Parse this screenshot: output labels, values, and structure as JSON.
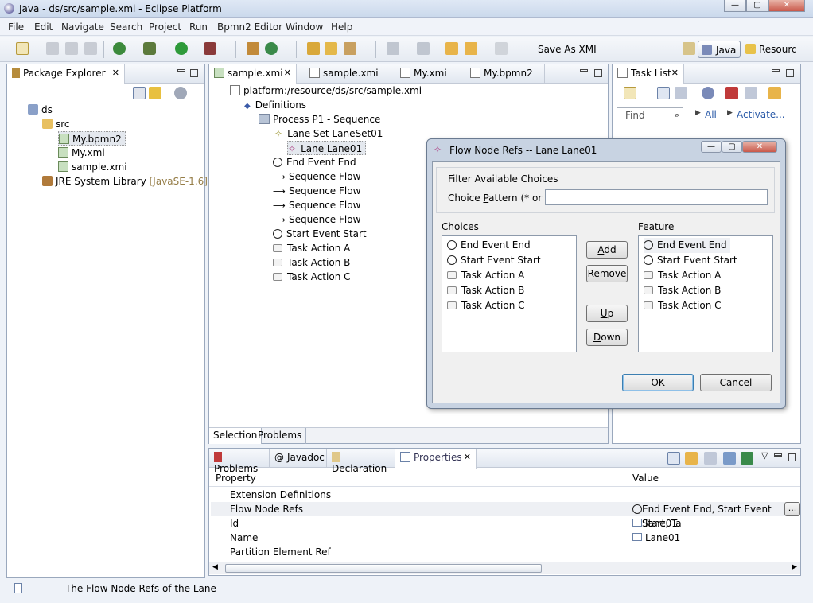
{
  "window": {
    "title": "Java - ds/src/sample.xmi - Eclipse Platform"
  },
  "menu": [
    "File",
    "Edit",
    "Navigate",
    "Search",
    "Project",
    "Run",
    "Bpmn2 Editor",
    "Window",
    "Help"
  ],
  "toolbar": {
    "save_as_xmi": "Save As XMI"
  },
  "perspectives": {
    "java": "Java",
    "resource": "Resourc"
  },
  "package_explorer": {
    "title": "Package Explorer",
    "items": [
      "ds",
      "src",
      "My.bpmn2",
      "My.xmi",
      "sample.xmi",
      "JRE System Library"
    ],
    "jre_suffix": "[JavaSE-1.6]"
  },
  "editor": {
    "tabs": [
      "sample.xmi",
      "sample.xmi",
      "My.xmi",
      "My.bpmn2"
    ],
    "tree": [
      "platform:/resource/ds/src/sample.xmi",
      "Definitions",
      "Process P1 - Sequence",
      "Lane Set LaneSet01",
      "Lane Lane01",
      "End Event End",
      "Sequence Flow",
      "Sequence Flow",
      "Sequence Flow",
      "Sequence Flow",
      "Start Event Start",
      "Task Action A",
      "Task Action B",
      "Task Action C"
    ],
    "bottom_tabs": [
      "Selection",
      "Problems"
    ]
  },
  "task_list": {
    "title": "Task List",
    "find_placeholder": "Find",
    "all": "All",
    "activate": "Activate..."
  },
  "dialog": {
    "title": "Flow Node Refs -- Lane Lane01",
    "filter_group": "Filter Available Choices",
    "choice_pattern_label": "Choice Pattern (* or ?)",
    "choice_pattern_value": "",
    "choices_label": "Choices",
    "feature_label": "Feature",
    "choices": [
      "End Event End",
      "Start Event Start",
      "Task Action A",
      "Task Action B",
      "Task Action C"
    ],
    "features": [
      "End Event End",
      "Start Event Start",
      "Task Action A",
      "Task Action B",
      "Task Action C"
    ],
    "add": "Add",
    "remove": "Remove",
    "up": "Up",
    "down": "Down",
    "ok": "OK",
    "cancel": "Cancel"
  },
  "bottom_panel": {
    "tabs": [
      "Problems",
      "Javadoc",
      "Declaration",
      "Properties"
    ],
    "col_property": "Property",
    "col_value": "Value",
    "rows": [
      {
        "name": "Extension Definitions",
        "value": ""
      },
      {
        "name": "Flow Node Refs",
        "value": "End Event End, Start Event Start, Ta"
      },
      {
        "name": "Id",
        "value": "lane01"
      },
      {
        "name": "Name",
        "value": "Lane01"
      },
      {
        "name": "Partition Element Ref",
        "value": ""
      }
    ],
    "ellipsis": "..."
  },
  "status": {
    "text": "The Flow Node Refs of the Lane"
  }
}
